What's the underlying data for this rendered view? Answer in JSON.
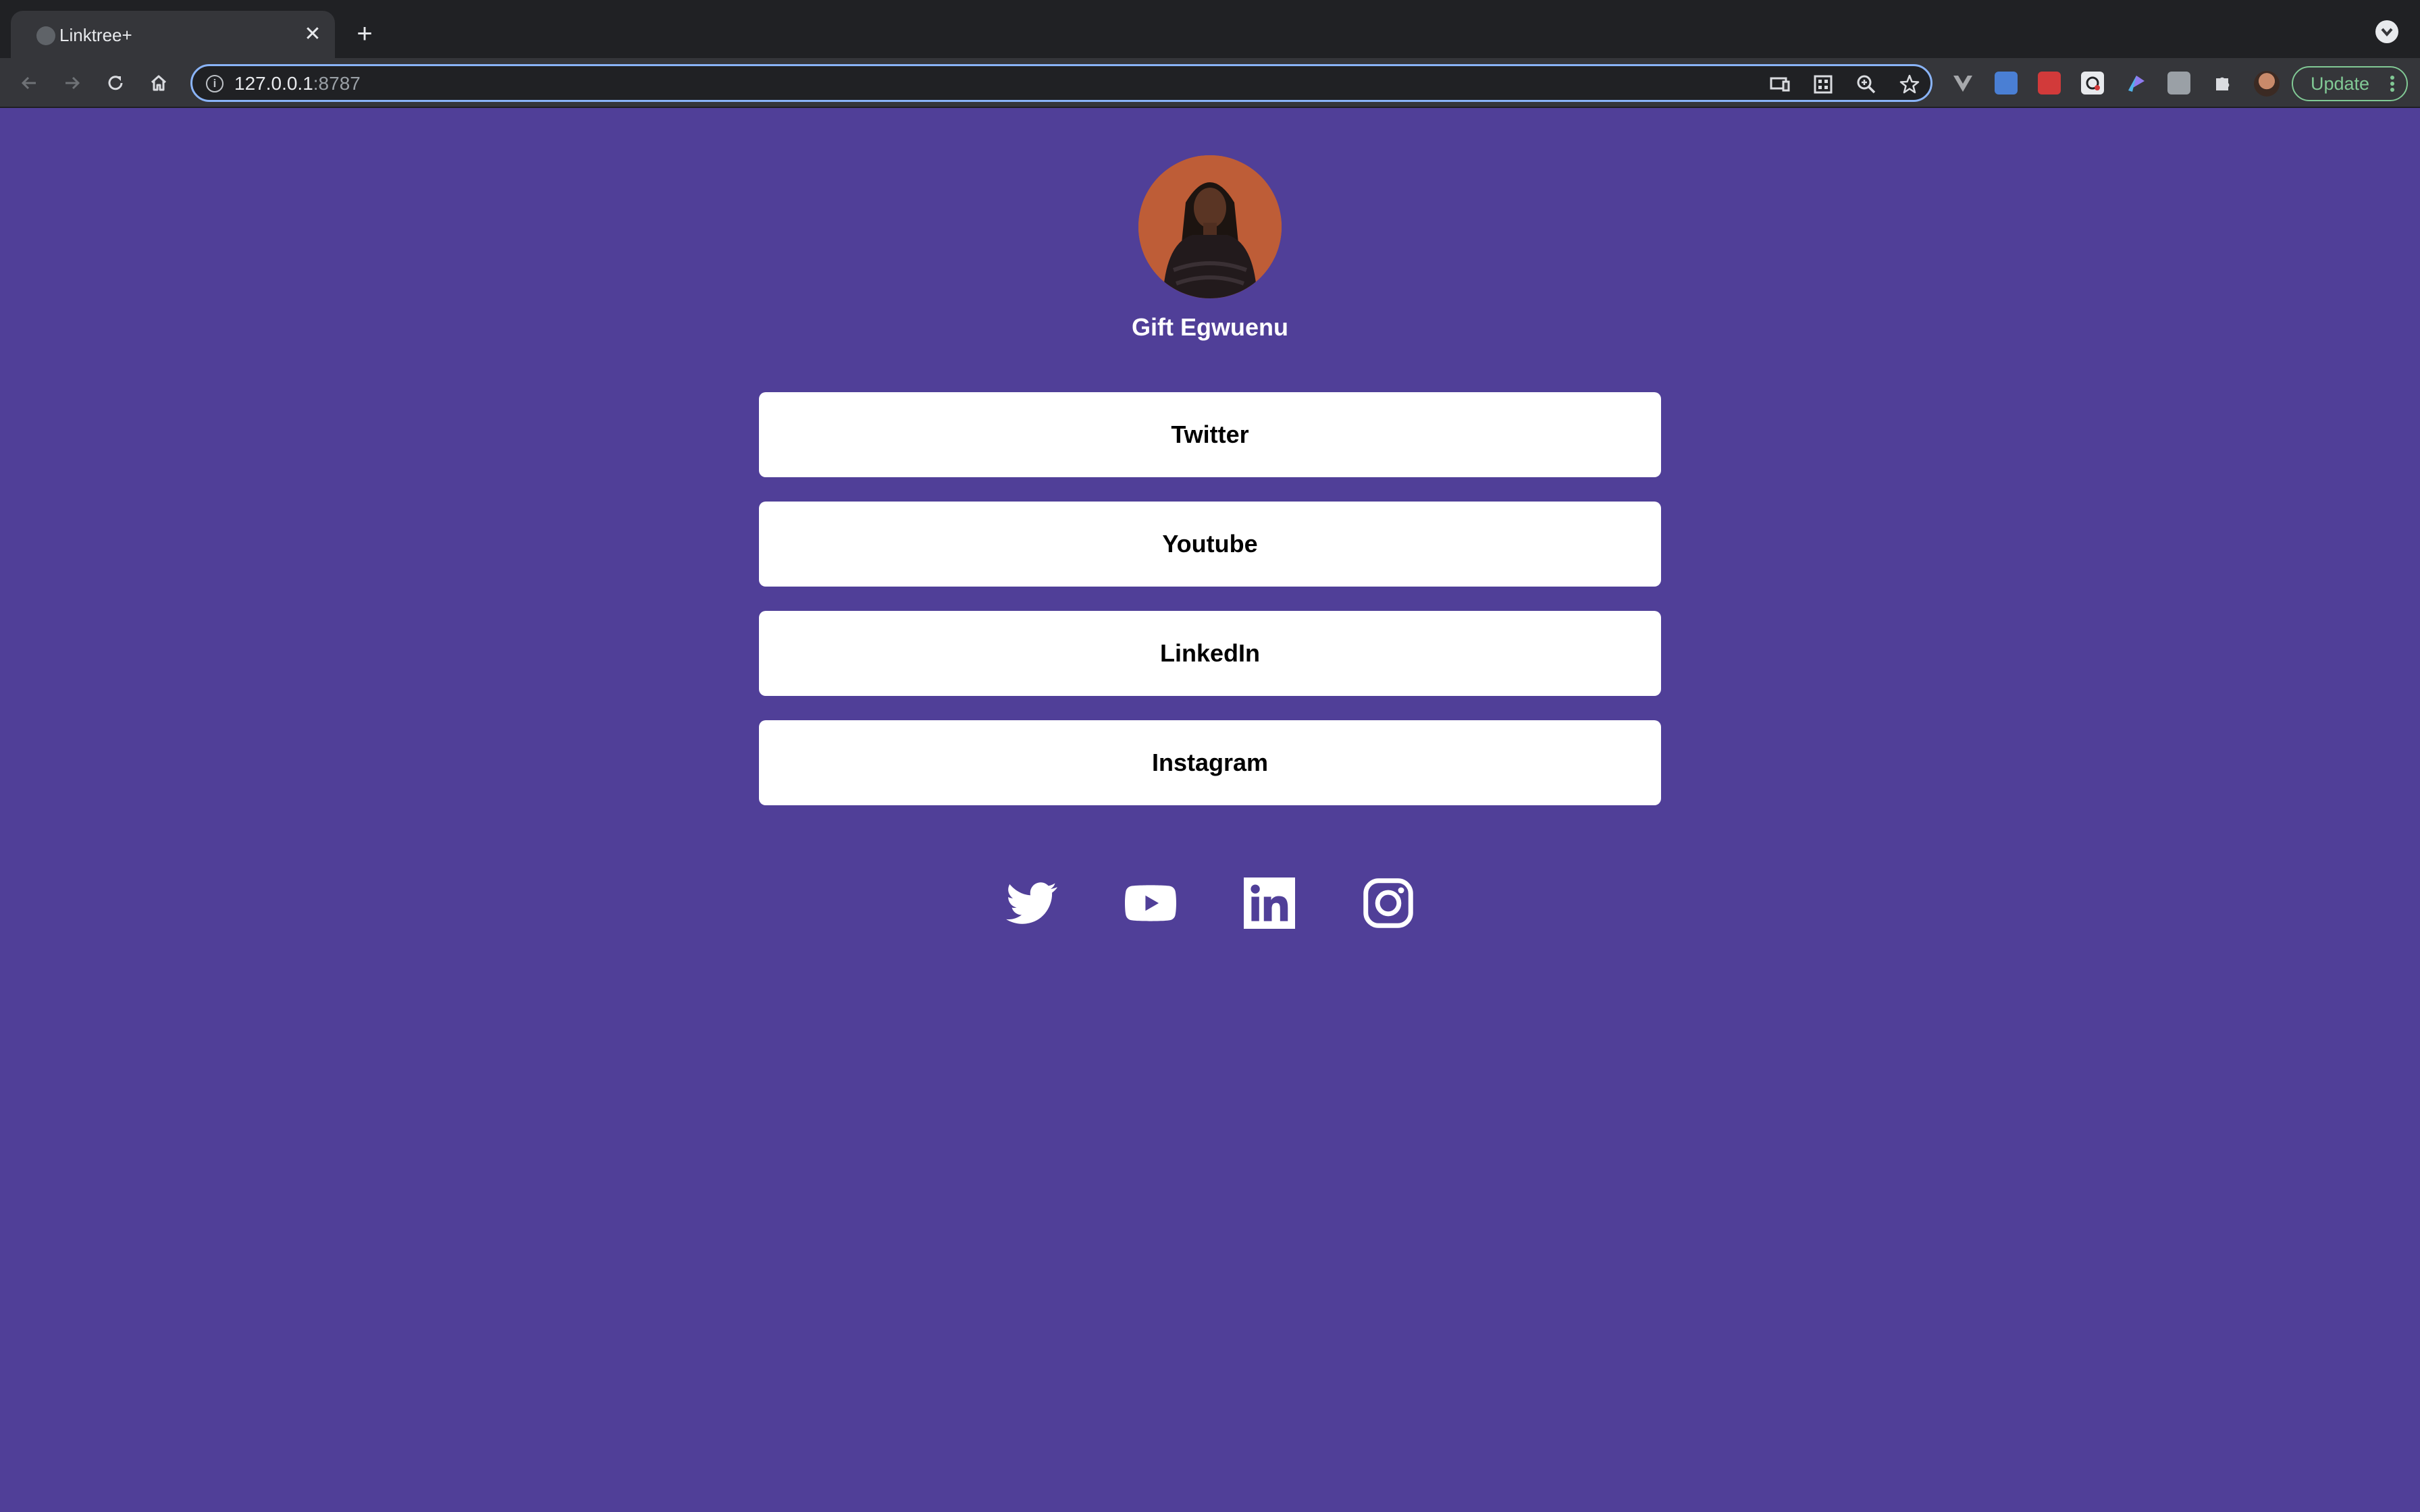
{
  "browser": {
    "tab_title": "Linktree+",
    "tab_close": "✕",
    "new_tab": "+",
    "url_host": "127.0.0.1",
    "url_port": ":8787",
    "update_label": "Update"
  },
  "profile": {
    "name": "Gift Egwuenu",
    "avatar_icon": "profile-photo"
  },
  "links": [
    {
      "label": "Twitter"
    },
    {
      "label": "Youtube"
    },
    {
      "label": "LinkedIn"
    },
    {
      "label": "Instagram"
    }
  ],
  "social_icons": [
    "twitter-icon",
    "youtube-icon",
    "linkedin-icon",
    "instagram-icon"
  ],
  "colors": {
    "page_background": "#503f98",
    "button_background": "#ffffff",
    "button_text": "#000000",
    "name_text": "#ffffff",
    "update_accent": "#81c995"
  }
}
